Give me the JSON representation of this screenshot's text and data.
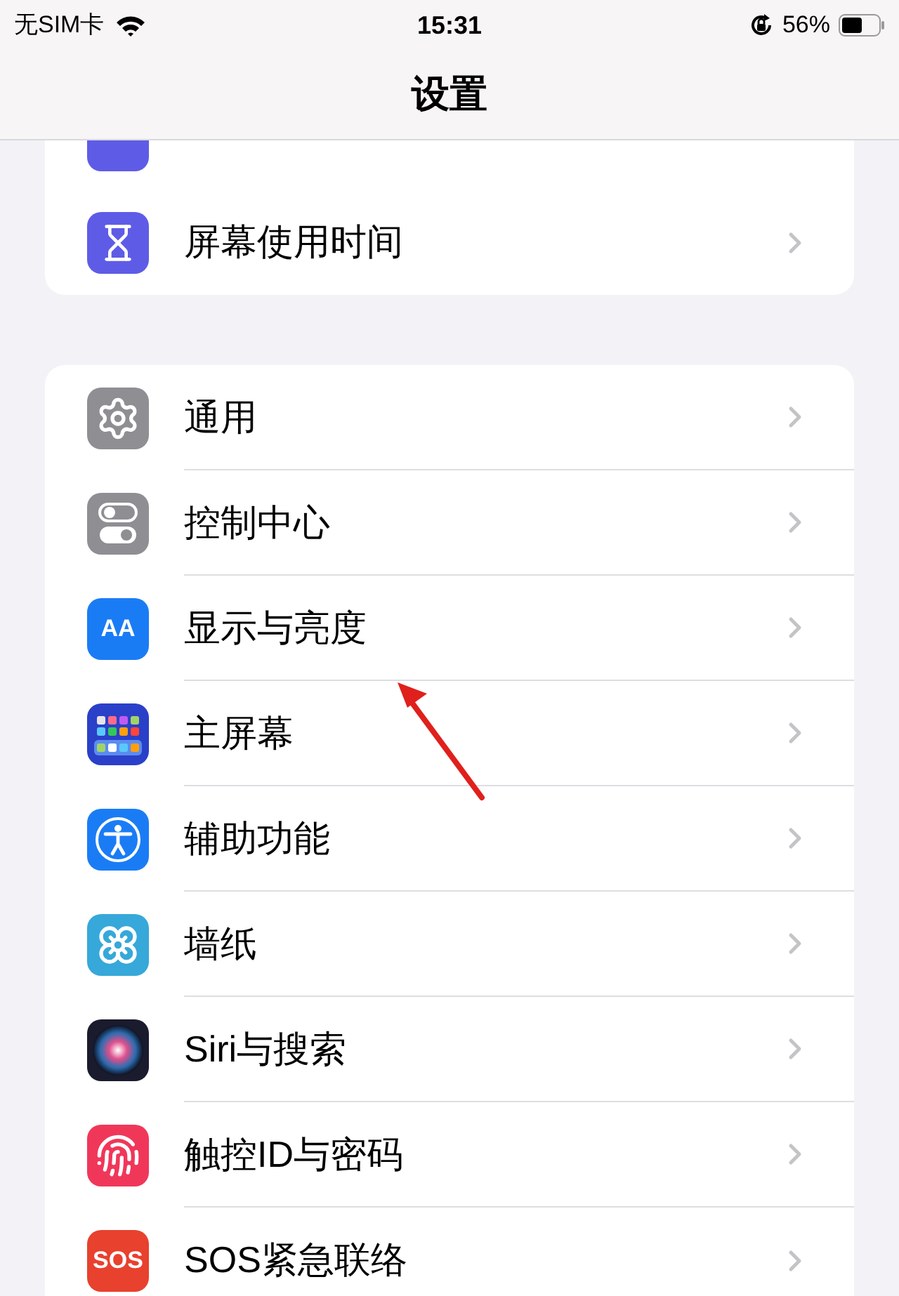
{
  "status_bar": {
    "carrier": "无SIM卡",
    "time": "15:31",
    "battery": "56%"
  },
  "header": {
    "title": "设置"
  },
  "groups": [
    {
      "items": [
        {
          "kind": "partial",
          "color": "#5e5ce6"
        },
        {
          "label": "屏幕使用时间",
          "kind": "hourglass",
          "color": "#5e5ce6"
        }
      ]
    },
    {
      "items": [
        {
          "label": "通用",
          "kind": "gear",
          "color": "#8e8e93"
        },
        {
          "label": "控制中心",
          "kind": "toggles",
          "color": "#8e8e93"
        },
        {
          "label": "显示与亮度",
          "kind": "lettered",
          "badge": "AA",
          "color": "#1a7cf5"
        },
        {
          "label": "主屏幕",
          "kind": "grid",
          "color": "#2a40c8"
        },
        {
          "label": "辅助功能",
          "kind": "accessibility",
          "color": "#1a7cf5"
        },
        {
          "label": "墙纸",
          "kind": "flower",
          "color": "#36a8d9"
        },
        {
          "label": "Siri与搜索",
          "kind": "siri",
          "color": "#1b1b2e"
        },
        {
          "label": "触控ID与密码",
          "kind": "fingerprint",
          "color": "#f0375a"
        },
        {
          "label": "SOS紧急联络",
          "kind": "lettered",
          "badge": "SOS",
          "color": "#e8412e"
        }
      ]
    }
  ]
}
